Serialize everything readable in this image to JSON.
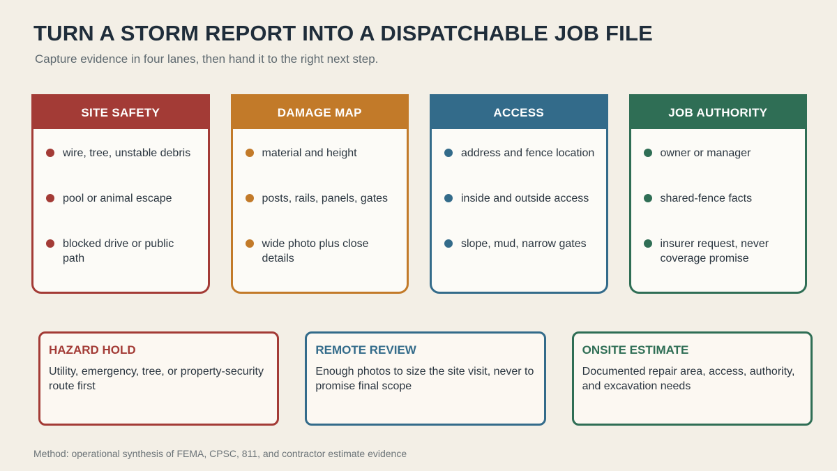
{
  "header": {
    "title": "TURN A STORM REPORT INTO A DISPATCHABLE JOB FILE",
    "subtitle": "Capture evidence in four lanes, then hand it to the right next step."
  },
  "lanes": [
    {
      "title": "SITE SAFETY",
      "color": "#a33b36",
      "items": [
        "wire, tree, unstable debris",
        "pool or animal escape",
        "blocked drive or public path"
      ]
    },
    {
      "title": "DAMAGE MAP",
      "color": "#c27a29",
      "items": [
        "material and height",
        "posts, rails, panels, gates",
        "wide photo plus close details"
      ]
    },
    {
      "title": "ACCESS",
      "color": "#336b8a",
      "items": [
        "address and fence location",
        "inside and outside access",
        "slope, mud, narrow gates"
      ]
    },
    {
      "title": "JOB AUTHORITY",
      "color": "#2f6e55",
      "items": [
        "owner or manager",
        "shared-fence facts",
        "insurer request, never coverage promise"
      ]
    }
  ],
  "outcomes": [
    {
      "title": "HAZARD HOLD",
      "color": "#a33b36",
      "text": "Utility, emergency, tree, or property-security route first"
    },
    {
      "title": "REMOTE REVIEW",
      "color": "#336b8a",
      "text": "Enough photos to size the site visit, never to promise final scope"
    },
    {
      "title": "ONSITE ESTIMATE",
      "color": "#2f6e55",
      "text": "Documented repair area, access, authority, and excavation needs"
    }
  ],
  "footnote": "Method: operational synthesis of FEMA, CPSC, 811, and contractor estimate evidence"
}
